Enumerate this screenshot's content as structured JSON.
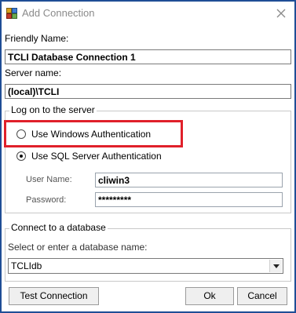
{
  "window": {
    "title": "Add Connection",
    "icon": "database-connection-icon",
    "close_icon": "close-icon"
  },
  "friendly_name": {
    "label": "Friendly Name:",
    "value": "TCLI Database Connection 1"
  },
  "server_name": {
    "label": "Server name:",
    "value": "(local)\\TCLI"
  },
  "logon": {
    "legend": "Log on to the server",
    "windows_auth": {
      "label": "Use Windows Authentication",
      "selected": false
    },
    "sql_auth": {
      "label": "Use SQL Server Authentication",
      "selected": true
    },
    "user_name": {
      "label": "User Name:",
      "value": "cliwin3"
    },
    "password": {
      "label": "Password:",
      "value": "*********"
    }
  },
  "database": {
    "legend": "Connect to a database",
    "select_label": "Select or enter a database name:",
    "selected": "TCLIdb"
  },
  "buttons": {
    "test": "Test Connection",
    "ok": "Ok",
    "cancel": "Cancel"
  },
  "colors": {
    "frame_border": "#1f4e96",
    "highlight": "#e0202a"
  }
}
